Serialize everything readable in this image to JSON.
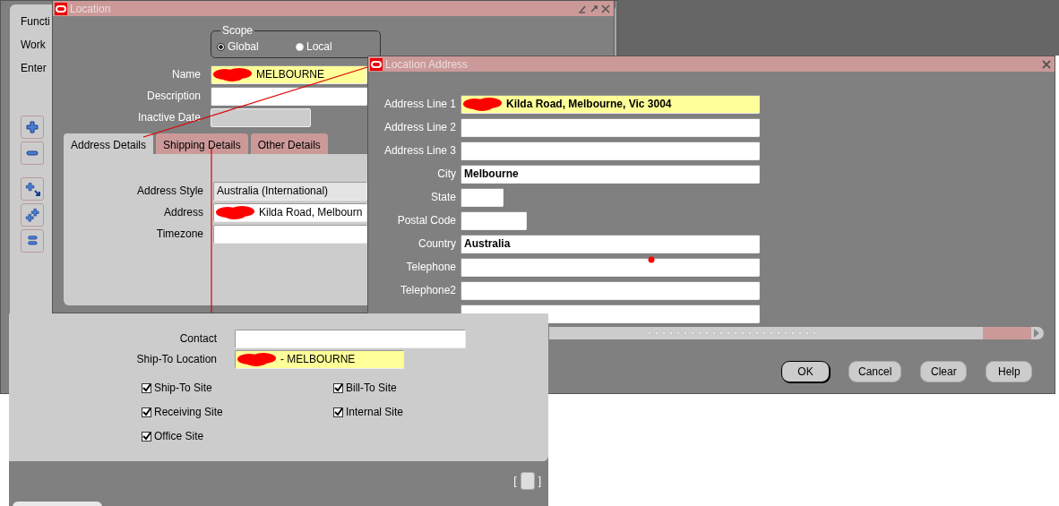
{
  "background_window": {
    "labels": [
      "Functi",
      "Work",
      "Enter"
    ]
  },
  "location_window": {
    "title": "Location",
    "scope": {
      "legend": "Scope",
      "options": [
        {
          "label": "Global",
          "selected": true
        },
        {
          "label": "Local",
          "selected": false
        }
      ]
    },
    "fields": [
      {
        "label": "Name",
        "value": "MELBOURNE",
        "kind": "required",
        "redacted": true
      },
      {
        "label": "Description",
        "kind": "text",
        "redacted": false
      },
      {
        "label": "Inactive Date",
        "kind": "disabled",
        "redacted": false
      }
    ],
    "tabs": [
      {
        "label": "Address Details",
        "selected": true
      },
      {
        "label": "Shipping Details",
        "selected": false
      },
      {
        "label": "Other Details",
        "selected": false
      }
    ],
    "address_fields": [
      {
        "label": "Address Style",
        "value": "Australia (International)",
        "kind": "list",
        "redacted": false
      },
      {
        "label": "Address",
        "value": "Kilda Road, Melbourn",
        "kind": "text",
        "redacted": true
      },
      {
        "label": "Timezone",
        "kind": "text",
        "redacted": false
      }
    ]
  },
  "location_address_window": {
    "title": "Location Address",
    "fields": [
      {
        "label": "Address Line 1",
        "value": "Kilda Road, Melbourne, Vic 3004",
        "kind": "required",
        "redacted": true
      },
      {
        "label": "Address Line 2",
        "kind": "text",
        "redacted": false
      },
      {
        "label": "Address Line 3",
        "kind": "text",
        "redacted": false
      },
      {
        "label": "City",
        "value": "Melbourne",
        "kind": "text",
        "redacted": false
      },
      {
        "label": "State",
        "kind": "text",
        "redacted": false
      },
      {
        "label": "Postal Code",
        "kind": "text",
        "redacted": false
      },
      {
        "label": "Country",
        "value": "Australia",
        "kind": "text",
        "redacted": false
      },
      {
        "label": "Telephone",
        "kind": "text",
        "redacted": false
      },
      {
        "label": "Telephone2",
        "kind": "text",
        "redacted": false
      },
      {
        "kind": "text",
        "redacted": false
      }
    ],
    "buttons": [
      {
        "label": "OK",
        "default": true
      },
      {
        "label": "Cancel",
        "default": false
      },
      {
        "label": "Clear",
        "default": false
      },
      {
        "label": "Help",
        "default": false
      }
    ]
  },
  "shipping_panel": {
    "fields": [
      {
        "label": "Contact",
        "kind": "text",
        "redacted": false
      },
      {
        "label": "Ship-To Location",
        "value": "- MELBOURNE",
        "kind": "required",
        "redacted": true
      }
    ],
    "checkboxes": [
      {
        "label": "Ship-To Site",
        "checked": true
      },
      {
        "label": "Bill-To Site",
        "checked": true
      },
      {
        "label": "Receiving Site",
        "checked": true
      },
      {
        "label": "Internal Site",
        "checked": true
      },
      {
        "label": "Office Site",
        "checked": true
      }
    ],
    "bracket_open": "[",
    "bracket_close": "]"
  }
}
